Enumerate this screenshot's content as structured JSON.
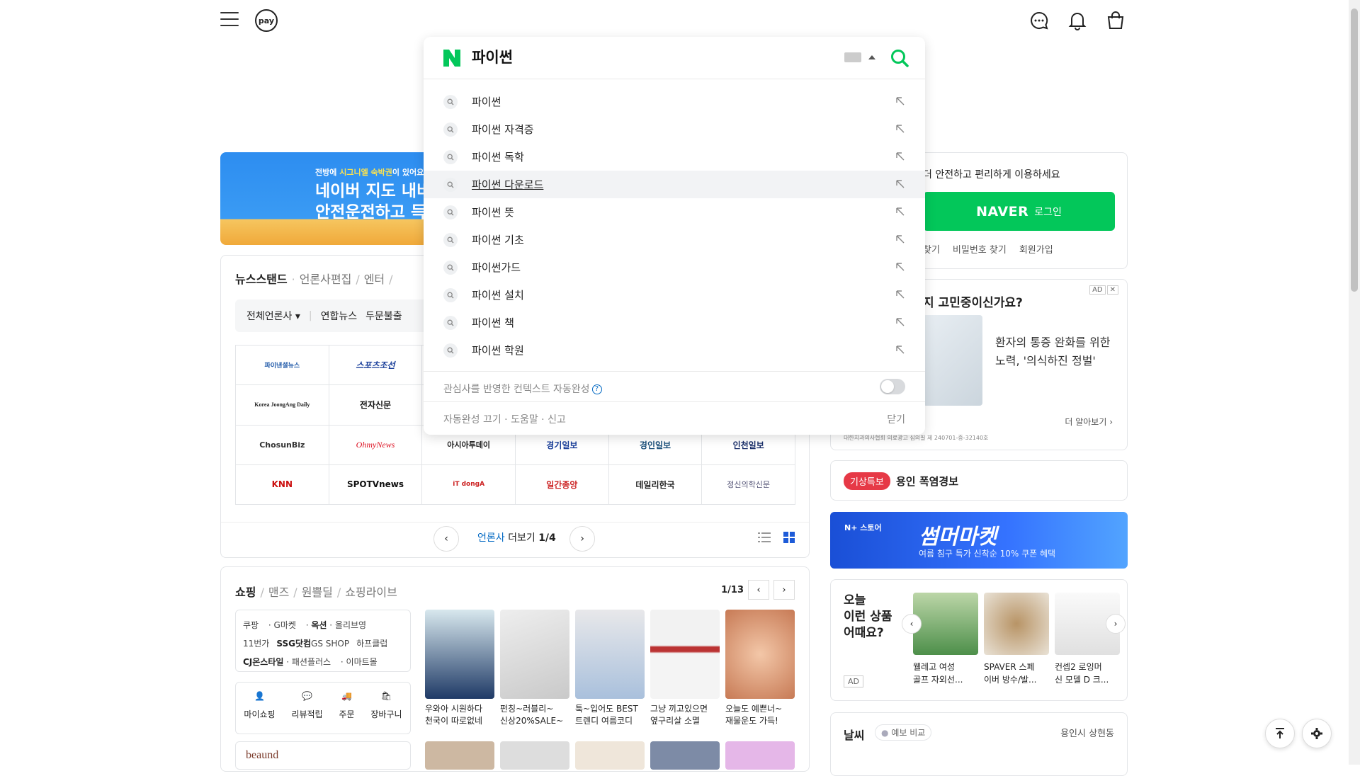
{
  "header": {
    "pay_label": "pay"
  },
  "search": {
    "query": "파이썬",
    "suggestions": [
      "파이썬",
      "파이썬 자격증",
      "파이썬 독학",
      "파이썬 다운로드",
      "파이썬 뜻",
      "파이썬 기초",
      "파이썬가드",
      "파이썬 설치",
      "파이썬 책",
      "파이썬 학원"
    ],
    "highlighted_index": 3,
    "context_label": "관심사를 반영한 컨텍스트 자동완성",
    "help_mark": "?",
    "footer_links": "자동완성 끄기 · 도움말 · 신고",
    "close_label": "닫기"
  },
  "banner": {
    "line1_pre": "전방에 ",
    "line1_hl": "시그니엘 숙박권",
    "line1_post": "이 있어요",
    "line2": "네이버 지도 내비",
    "line3": "안전운전하고 득"
  },
  "newsstand": {
    "tabs": [
      "뉴스스탠드",
      "언론사편집",
      "엔터"
    ],
    "filter": [
      "전체언론사",
      "연합뉴스",
      "두문불출"
    ],
    "press": [
      [
        "파이낸셜뉴스",
        "스포츠조선",
        "",
        "",
        "",
        ""
      ],
      [
        "Korea JoongAng Daily",
        "전자신문",
        "",
        "",
        "",
        ""
      ],
      [
        "ChosunBiz",
        "OhmyNews",
        "아시아투데이",
        "경기일보",
        "경인일보",
        "인천일보"
      ],
      [
        "KNN",
        "SPOTVnews",
        "iT dongA",
        "일간종앙",
        "데일리한국",
        "정신의학신문"
      ]
    ],
    "more_pre": "언론사",
    "more_post": " 더보기 ",
    "page": "1/4"
  },
  "shopping": {
    "tabs": [
      "쇼핑",
      "맨즈",
      "원쁠딜",
      "쇼핑라이브"
    ],
    "page": "1/13",
    "malls": [
      [
        "쿠팡",
        "G마켓",
        "옥션",
        "올리브영"
      ],
      [
        "11번가",
        "SSG닷컴",
        "GS SHOP",
        "하프클럽"
      ],
      [
        "CJ온스타일",
        "패션플러스",
        "이마트몰"
      ]
    ],
    "quick": [
      "마이쇼핑",
      "리뷰적립",
      "주문",
      "장바구니"
    ],
    "products": [
      {
        "l1": "우와아 시원하다",
        "l2": "천국이 따로없네"
      },
      {
        "l1": "펀칭~러블리~",
        "l2": "신상20%SALE~"
      },
      {
        "l1": "툭~입어도 BEST",
        "l2": "트렌디 여름코디"
      },
      {
        "l1": "그냥 끼고있으면",
        "l2": "옆구리살 소멸"
      },
      {
        "l1": "오늘도 예쁜너~",
        "l2": "재물운도 가득!"
      }
    ],
    "brand": "beaund"
  },
  "login": {
    "message": "더 안전하고 편리하게 이용하세요",
    "button_brand": "NAVER",
    "button_label": "로그인",
    "links": [
      "찾기",
      "비밀번호 찾기",
      "회원가입"
    ]
  },
  "ad": {
    "title": "지 고민중이신가요?",
    "badge": "AD",
    "text": "환자의 통증 완화를 위한 노력, '의식하진 정벌'",
    "more": "더 알아보기",
    "note": "대한치과의사협회 의료광고 심의필 제 240701-중-32140호"
  },
  "weather_alert": {
    "badge": "기상특보",
    "text": "용인 폭염경보"
  },
  "store_banner": {
    "brand": "N+ 스토어",
    "title": "썸머마켓",
    "subtitle": "여름 침구 특가 신착순 10% 쿠폰 혜택"
  },
  "recommend": {
    "title": "오늘\n이런 상품\n어때요?",
    "ad": "AD",
    "items": [
      {
        "l1": "웰레고 여성",
        "l2": "골프 자외선..."
      },
      {
        "l1": "SPAVER 스페",
        "l2": "이버 방수/발..."
      },
      {
        "l1": "컨셉2 로잉머",
        "l2": "신 모델 D 크..."
      }
    ]
  },
  "weather": {
    "title": "날씨",
    "compare": "예보 비교",
    "location": "용인시 상현동"
  },
  "colors": {
    "naver_green": "#03c75a",
    "link_blue": "#0068c3",
    "alert_red": "#e63946"
  }
}
